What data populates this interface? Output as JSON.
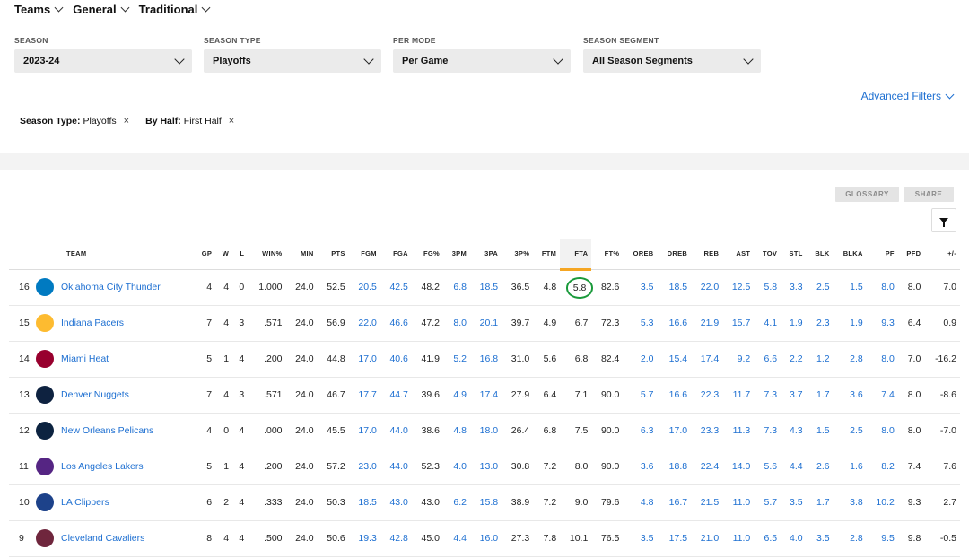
{
  "nav": {
    "items": [
      "Teams",
      "General",
      "Traditional"
    ]
  },
  "filters": [
    {
      "label": "SEASON",
      "value": "2023-24"
    },
    {
      "label": "SEASON TYPE",
      "value": "Playoffs"
    },
    {
      "label": "PER MODE",
      "value": "Per Game"
    },
    {
      "label": "SEASON SEGMENT",
      "value": "All Season Segments"
    }
  ],
  "advanced_filters": "Advanced Filters",
  "chips": [
    {
      "key": "Season Type:",
      "value": "Playoffs",
      "remove": "×"
    },
    {
      "key": "By Half:",
      "value": "First Half",
      "remove": "×"
    }
  ],
  "buttons": {
    "glossary": "GLOSSARY",
    "share": "SHARE"
  },
  "table": {
    "columns": [
      "TEAM",
      "GP",
      "W",
      "L",
      "WIN%",
      "MIN",
      "PTS",
      "FGM",
      "FGA",
      "FG%",
      "3PM",
      "3PA",
      "3P%",
      "FTM",
      "FTA",
      "FT%",
      "OREB",
      "DREB",
      "REB",
      "AST",
      "TOV",
      "STL",
      "BLK",
      "BLKA",
      "PF",
      "PFD",
      "+/-"
    ],
    "sorted_column": "FTA",
    "rows": [
      {
        "rank": "16",
        "team": "Oklahoma City Thunder",
        "logo_color": "#007ac1",
        "stats": [
          "4",
          "4",
          "0",
          "1.000",
          "24.0",
          "52.5",
          "20.5",
          "42.5",
          "48.2",
          "6.8",
          "18.5",
          "36.5",
          "4.8",
          "5.8",
          "82.6",
          "3.5",
          "18.5",
          "22.0",
          "12.5",
          "5.8",
          "3.3",
          "2.5",
          "1.5",
          "8.0",
          "8.0",
          "7.0"
        ]
      },
      {
        "rank": "15",
        "team": "Indiana Pacers",
        "logo_color": "#fdbb30",
        "stats": [
          "7",
          "4",
          "3",
          ".571",
          "24.0",
          "56.9",
          "22.0",
          "46.6",
          "47.2",
          "8.0",
          "20.1",
          "39.7",
          "4.9",
          "6.7",
          "72.3",
          "5.3",
          "16.6",
          "21.9",
          "15.7",
          "4.1",
          "1.9",
          "2.3",
          "1.9",
          "9.3",
          "6.4",
          "0.9"
        ]
      },
      {
        "rank": "14",
        "team": "Miami Heat",
        "logo_color": "#98002e",
        "stats": [
          "5",
          "1",
          "4",
          ".200",
          "24.0",
          "44.8",
          "17.0",
          "40.6",
          "41.9",
          "5.2",
          "16.8",
          "31.0",
          "5.6",
          "6.8",
          "82.4",
          "2.0",
          "15.4",
          "17.4",
          "9.2",
          "6.6",
          "2.2",
          "1.2",
          "2.8",
          "8.0",
          "7.0",
          "-16.2"
        ]
      },
      {
        "rank": "13",
        "team": "Denver Nuggets",
        "logo_color": "#0e2240",
        "stats": [
          "7",
          "4",
          "3",
          ".571",
          "24.0",
          "46.7",
          "17.7",
          "44.7",
          "39.6",
          "4.9",
          "17.4",
          "27.9",
          "6.4",
          "7.1",
          "90.0",
          "5.7",
          "16.6",
          "22.3",
          "11.7",
          "7.3",
          "3.7",
          "1.7",
          "3.6",
          "7.4",
          "8.0",
          "-8.6"
        ]
      },
      {
        "rank": "12",
        "team": "New Orleans Pelicans",
        "logo_color": "#0c2340",
        "stats": [
          "4",
          "0",
          "4",
          ".000",
          "24.0",
          "45.5",
          "17.0",
          "44.0",
          "38.6",
          "4.8",
          "18.0",
          "26.4",
          "6.8",
          "7.5",
          "90.0",
          "6.3",
          "17.0",
          "23.3",
          "11.3",
          "7.3",
          "4.3",
          "1.5",
          "2.5",
          "8.0",
          "8.0",
          "-7.0"
        ]
      },
      {
        "rank": "11",
        "team": "Los Angeles Lakers",
        "logo_color": "#552583",
        "stats": [
          "5",
          "1",
          "4",
          ".200",
          "24.0",
          "57.2",
          "23.0",
          "44.0",
          "52.3",
          "4.0",
          "13.0",
          "30.8",
          "7.2",
          "8.0",
          "90.0",
          "3.6",
          "18.8",
          "22.4",
          "14.0",
          "5.6",
          "4.4",
          "2.6",
          "1.6",
          "8.2",
          "7.4",
          "7.6"
        ]
      },
      {
        "rank": "10",
        "team": "LA Clippers",
        "logo_color": "#1d428a",
        "stats": [
          "6",
          "2",
          "4",
          ".333",
          "24.0",
          "50.3",
          "18.5",
          "43.0",
          "43.0",
          "6.2",
          "15.8",
          "38.9",
          "7.2",
          "9.0",
          "79.6",
          "4.8",
          "16.7",
          "21.5",
          "11.0",
          "5.7",
          "3.5",
          "1.7",
          "3.8",
          "10.2",
          "9.3",
          "2.7"
        ]
      },
      {
        "rank": "9",
        "team": "Cleveland Cavaliers",
        "logo_color": "#6f263d",
        "stats": [
          "8",
          "4",
          "4",
          ".500",
          "24.0",
          "50.6",
          "19.3",
          "42.8",
          "45.0",
          "4.4",
          "16.0",
          "27.3",
          "7.8",
          "10.1",
          "76.5",
          "3.5",
          "17.5",
          "21.0",
          "11.0",
          "6.5",
          "4.0",
          "3.5",
          "2.8",
          "9.5",
          "9.8",
          "-0.5"
        ]
      }
    ],
    "link_columns": [
      "FGM",
      "FGA",
      "3PM",
      "3PA",
      "OREB",
      "DREB",
      "REB",
      "AST",
      "TOV",
      "STL",
      "BLK",
      "BLKA",
      "PF"
    ],
    "highlight": {
      "row": 0,
      "column": "FTA",
      "value": "5.8",
      "color": "#1a9a3b"
    }
  }
}
